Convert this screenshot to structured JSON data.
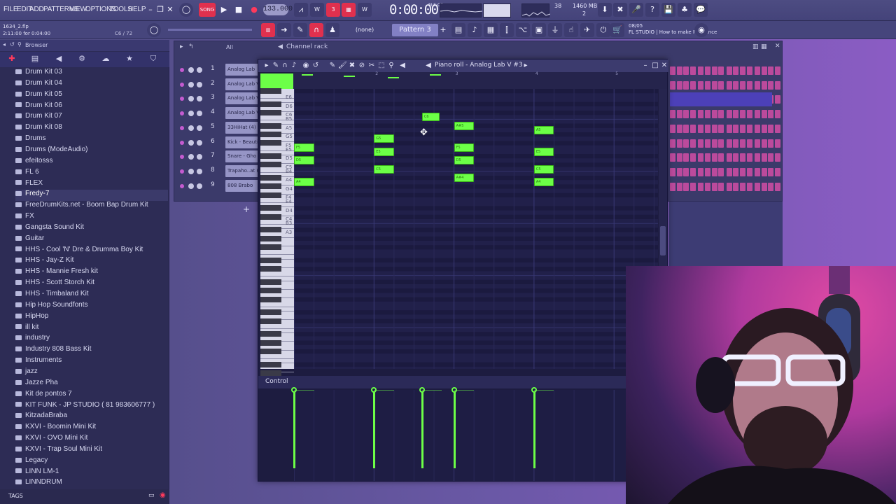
{
  "menu": [
    "FILE",
    "EDIT",
    "ADD",
    "PATTERNS",
    "VIEW",
    "OPTIONS",
    "TOOLS",
    "HELP"
  ],
  "transport": {
    "tempo": "133.000",
    "time": "0:00:00",
    "time_unit": "M:S:CS",
    "cpu": "38",
    "memory": "1460 MB",
    "polyphony": "2"
  },
  "project": {
    "file_name": "1634_2.flp",
    "file_time": "2:11:00 for 0:04:00",
    "cpu_hint": "C6 / 72"
  },
  "toolbar2": {
    "snap": "(none)",
    "pattern": "Pattern 3",
    "news_date": "08/05",
    "news_text": "FL STUDIO | How to make Psytrance"
  },
  "browser": {
    "title": "Browser",
    "tags_label": "TAGS",
    "items": [
      "Drum Kit 03",
      "Drum Kit 04",
      "Drum Kit 05",
      "Drum Kit 06",
      "Drum Kit 07",
      "Drum Kit 08",
      "Drums",
      "Drums (ModeAudio)",
      "efeitosss",
      "FL 6",
      "FLEX",
      "Fredy-7",
      "FreeDrumKits.net - Boom Bap Drum Kit",
      "FX",
      "Gangsta Sound Kit",
      "Guitar",
      "HHS - Cool 'N' Dre & Drumma Boy Kit",
      "HHS - Jay-Z Kit",
      "HHS - Mannie Fresh kit",
      "HHS - Scott Storch Kit",
      "HHS - Timbaland Kit",
      "Hip Hop Soundfonts",
      "HipHop",
      "ill kit",
      "industry",
      "Industry 808 Bass Kit",
      "Instruments",
      "jazz",
      "Jazze Pha",
      "Kit de pontos 7",
      "KIT FUNK - JP STUDIO ( 81 983606777 )",
      "KitzadaBraba",
      "KXVI - Boomin Mini Kit",
      "KXVI - OVO Mini Kit",
      "KXVI - Trap Soul Mini Kit",
      "Legacy",
      "LINN LM-1",
      "LINNDRUM"
    ],
    "selected_index": 11
  },
  "channel_rack": {
    "title": "Channel rack",
    "filter": "All",
    "channels": [
      {
        "num": "1",
        "name": "Analog Lab"
      },
      {
        "num": "2",
        "name": "Analog Lab V"
      },
      {
        "num": "3",
        "name": "Analog Lab V"
      },
      {
        "num": "4",
        "name": "Analog Lab V"
      },
      {
        "num": "5",
        "name": "33HiHat (4)"
      },
      {
        "num": "6",
        "name": "Kick - Beautif"
      },
      {
        "num": "7",
        "name": "Snare - Gho"
      },
      {
        "num": "8",
        "name": "Trapaho..at (2"
      },
      {
        "num": "9",
        "name": "808 Brabo"
      }
    ]
  },
  "piano_roll": {
    "title": "Piano roll - Analog Lab V #3",
    "bars": [
      "2",
      "3",
      "4",
      "5"
    ],
    "key_labels": [
      "E6",
      "D6",
      "C6",
      "B5",
      "A5",
      "G5",
      "F5",
      "E5",
      "D5",
      "C5",
      "B4",
      "A4",
      "G4",
      "F4",
      "E4",
      "D4",
      "C4",
      "B3",
      "A3"
    ],
    "notes": [
      {
        "label": "C6",
        "start": 2.6,
        "length": 0.22,
        "pitch": "C6"
      },
      {
        "label": "A#5",
        "start": 3.0,
        "length": 0.25,
        "pitch": "A#5"
      },
      {
        "label": "A5",
        "start": 4.0,
        "length": 0.25,
        "pitch": "A5"
      },
      {
        "label": "G5",
        "start": 2.0,
        "length": 0.25,
        "pitch": "G5"
      },
      {
        "label": "F5",
        "start": 1.0,
        "length": 0.25,
        "pitch": "F5"
      },
      {
        "label": "F5",
        "start": 3.0,
        "length": 0.25,
        "pitch": "F5"
      },
      {
        "label": "E5",
        "start": 2.0,
        "length": 0.25,
        "pitch": "E5"
      },
      {
        "label": "E5",
        "start": 4.0,
        "length": 0.25,
        "pitch": "E5"
      },
      {
        "label": "D5",
        "start": 1.0,
        "length": 0.25,
        "pitch": "D5"
      },
      {
        "label": "D5",
        "start": 3.0,
        "length": 0.25,
        "pitch": "D5"
      },
      {
        "label": "C5",
        "start": 2.0,
        "length": 0.25,
        "pitch": "C5"
      },
      {
        "label": "C5",
        "start": 4.0,
        "length": 0.25,
        "pitch": "C5"
      },
      {
        "label": "A#4",
        "start": 3.0,
        "length": 0.25,
        "pitch": "A#4"
      },
      {
        "label": "A4",
        "start": 1.0,
        "length": 0.25,
        "pitch": "A4"
      },
      {
        "label": "A4",
        "start": 4.0,
        "length": 0.25,
        "pitch": "A4"
      }
    ],
    "control_label": "Control",
    "velocity_positions": [
      1.0,
      2.0,
      2.6,
      3.0,
      4.0
    ]
  },
  "colors": {
    "note": "#6cff47",
    "accent_red": "#e0304e",
    "step_pink": "#bb4a9c"
  }
}
